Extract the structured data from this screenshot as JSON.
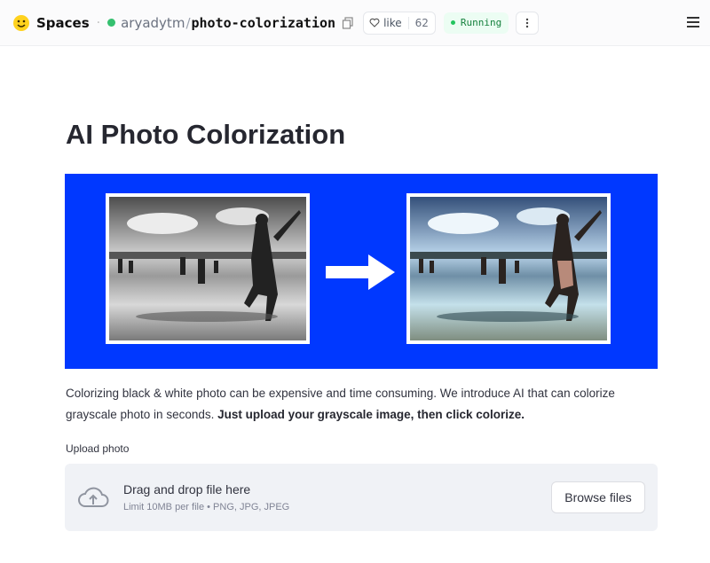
{
  "header": {
    "brand": "Spaces",
    "owner": "aryadytm",
    "slash": "/",
    "repo": "photo-colorization",
    "like_label": "like",
    "like_count": "62",
    "status": "Running"
  },
  "main": {
    "title": "AI Photo Colorization",
    "intro_text": "Colorizing black & white photo can be expensive and time consuming. We introduce AI that can colorize grayscale photo in seconds. ",
    "intro_bold": "Just upload your grayscale image, then click colorize.",
    "hero_bg_color": "#0038ff"
  },
  "uploader": {
    "label": "Upload photo",
    "drag_text": "Drag and drop file here",
    "limit_text": "Limit 10MB per file • PNG, JPG, JPEG",
    "browse_label": "Browse files"
  },
  "icons": [
    "huggingface-logo",
    "copy-icon",
    "heart-icon",
    "kebab-icon",
    "hamburger-menu-icon",
    "arrow-right-icon",
    "cloud-upload-icon"
  ]
}
